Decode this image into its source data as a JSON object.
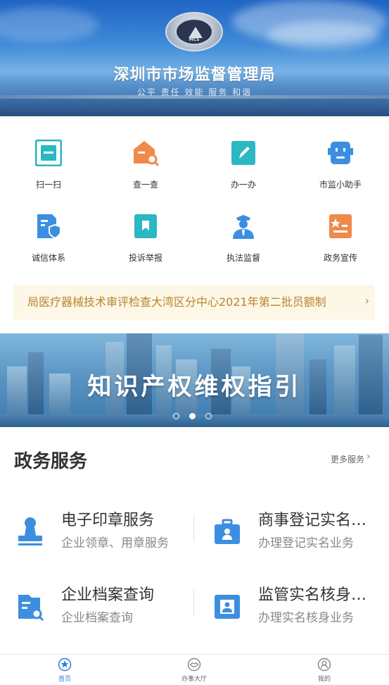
{
  "header": {
    "emblem_text": "MCS",
    "title": "深圳市市场监督管理局",
    "motto": "公平 责任 效能 服务 和谐"
  },
  "quick_actions": [
    {
      "label": "扫一扫",
      "icon": "scan-icon",
      "color": "#2bb7c4"
    },
    {
      "label": "查一查",
      "icon": "search-house-icon",
      "color": "#ef8a4a"
    },
    {
      "label": "办一办",
      "icon": "edit-icon",
      "color": "#2bb7c4"
    },
    {
      "label": "市监小助手",
      "icon": "robot-icon",
      "color": "#3c8fe0"
    },
    {
      "label": "诚信体系",
      "icon": "shield-doc-icon",
      "color": "#3c8fe0"
    },
    {
      "label": "投诉举报",
      "icon": "bookmark-doc-icon",
      "color": "#2bb7c4"
    },
    {
      "label": "执法监督",
      "icon": "officer-icon",
      "color": "#3c8fe0"
    },
    {
      "label": "政务宣传",
      "icon": "star-doc-icon",
      "color": "#ef8a4a"
    }
  ],
  "notice": {
    "text": "局医疗器械技术审评检查大湾区分中心2021年第二批员额制",
    "arrow": "›"
  },
  "banner": {
    "title": "知识产权维权指引",
    "slides": 3,
    "active_slide": 2
  },
  "services": {
    "title": "政务服务",
    "more_label": "更多服务",
    "more_arrow": "›",
    "items": [
      {
        "title": "电子印章服务",
        "subtitle": "企业领章、用章服务",
        "icon": "stamp-icon"
      },
      {
        "title": "商事登记实名…",
        "subtitle": "办理登记实名业务",
        "icon": "briefcase-id-icon"
      },
      {
        "title": "企业档案查询",
        "subtitle": "企业档案查询",
        "icon": "folder-search-icon"
      },
      {
        "title": "监管实名核身…",
        "subtitle": "办理实名核身业务",
        "icon": "id-card-icon"
      }
    ]
  },
  "tabbar": {
    "tabs": [
      {
        "label": "首页",
        "icon": "home-icon",
        "active": true
      },
      {
        "label": "办事大厅",
        "icon": "handshake-icon",
        "active": false
      },
      {
        "label": "我的",
        "icon": "user-icon",
        "active": false
      }
    ]
  },
  "colors": {
    "accent_blue": "#3c8fe0",
    "teal": "#2bb7c4",
    "orange": "#ef8a4a",
    "notice_text": "#b7852e",
    "notice_bg": "#fdf7e7"
  }
}
